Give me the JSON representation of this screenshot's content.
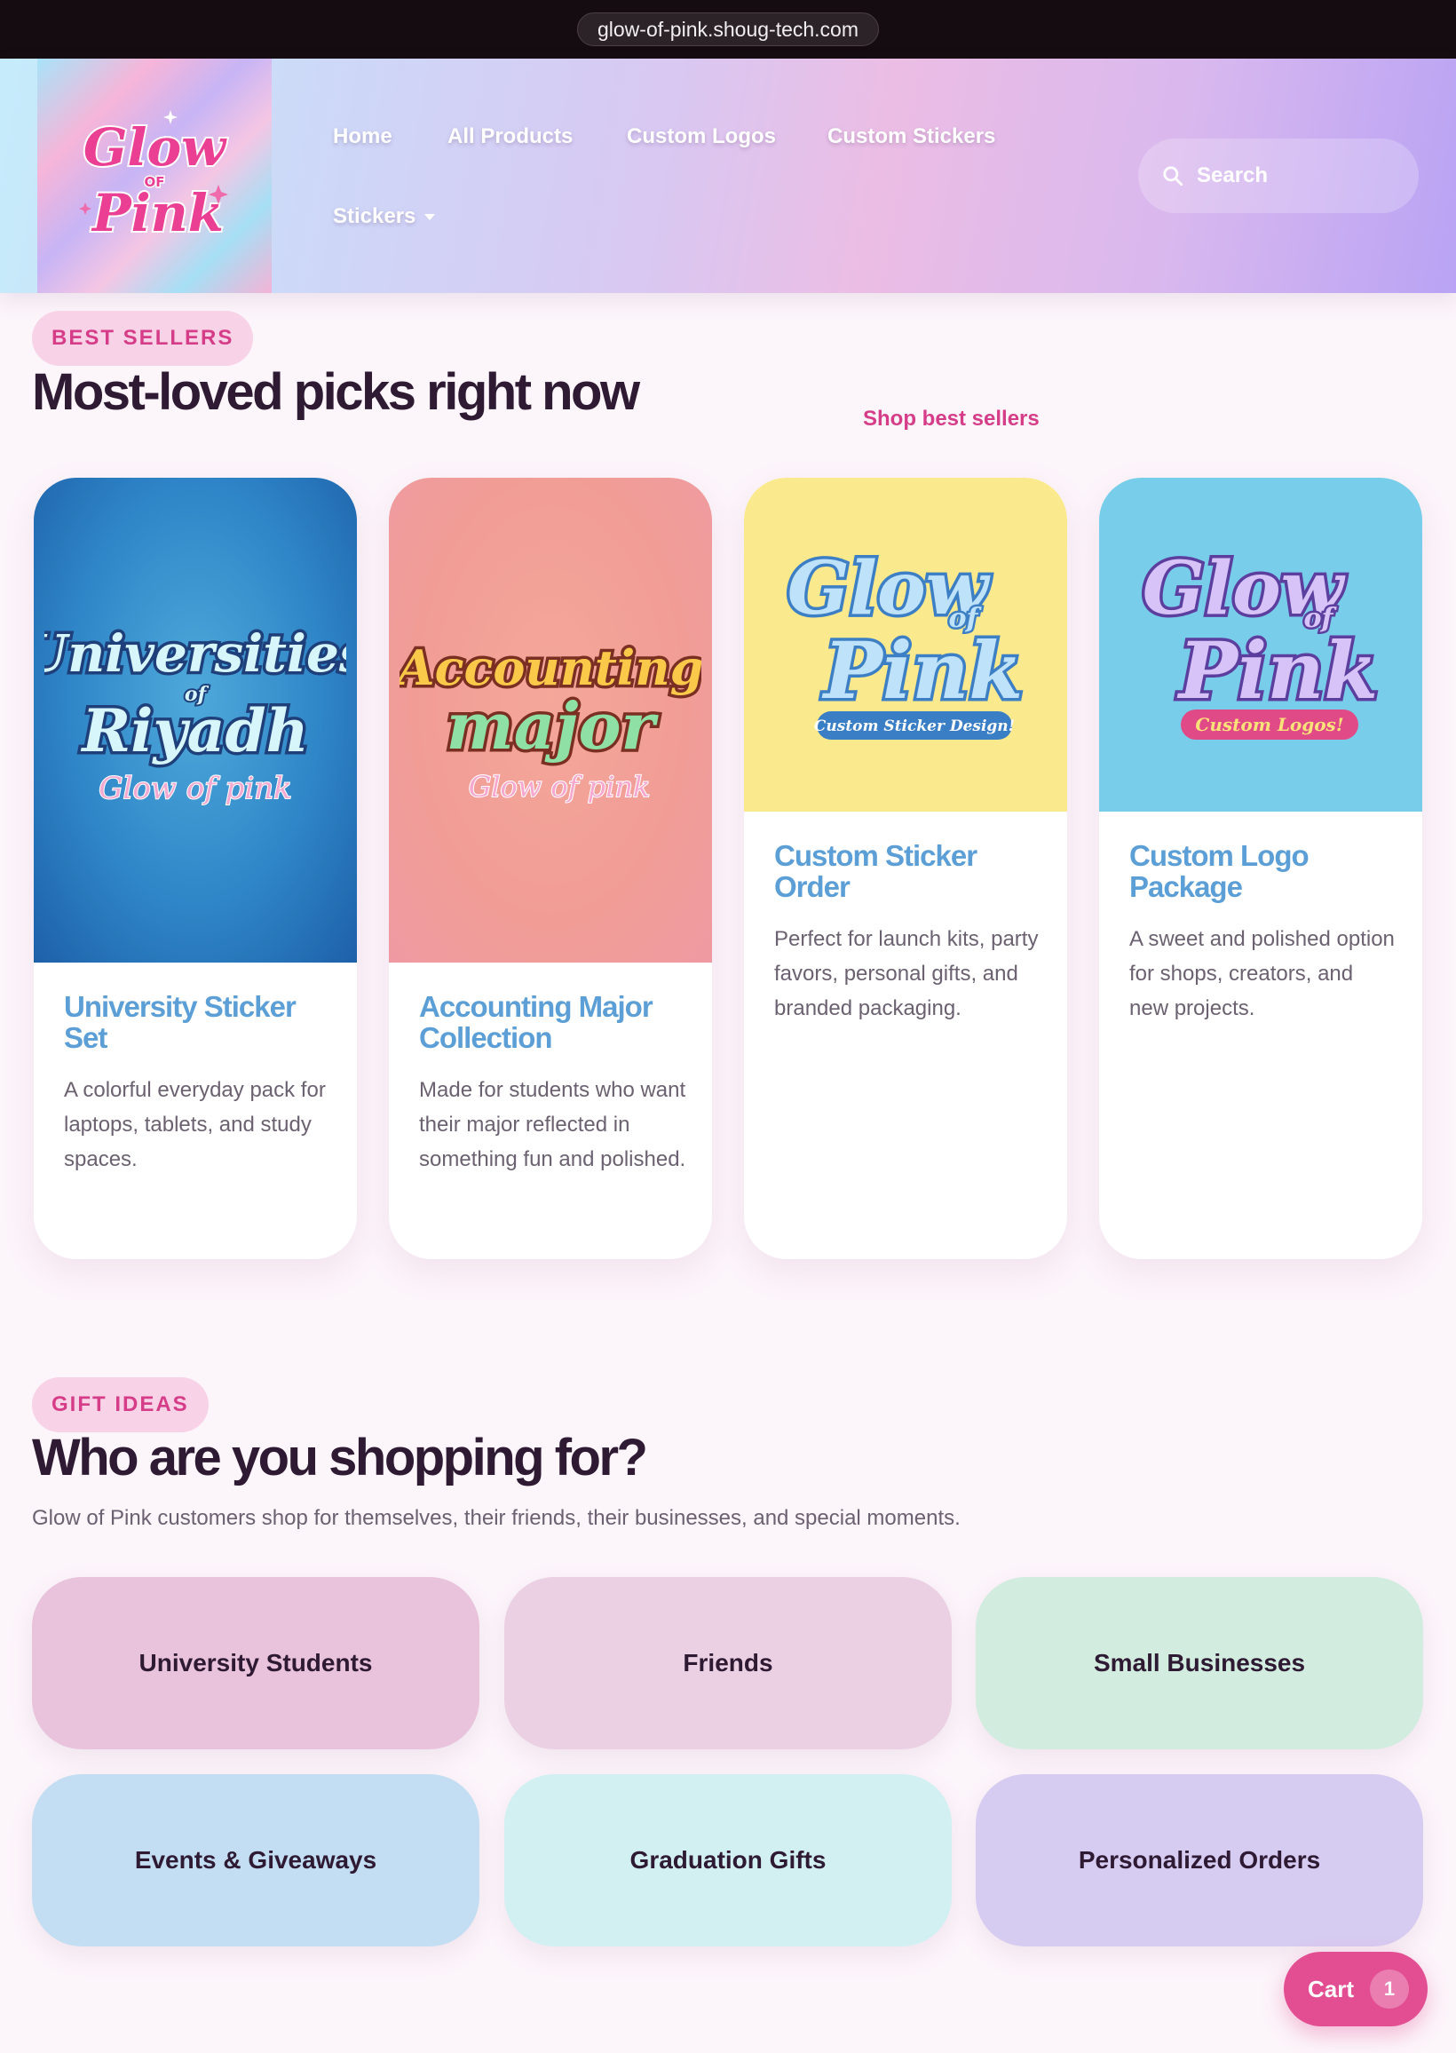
{
  "browser": {
    "url": "glow-of-pink.shoug-tech.com"
  },
  "header": {
    "logo": {
      "text_top": "Glow",
      "text_mid": "OF",
      "text_bottom": "Pink"
    },
    "nav": [
      {
        "label": "Home"
      },
      {
        "label": "All Products"
      },
      {
        "label": "Custom Logos"
      },
      {
        "label": "Custom Stickers"
      },
      {
        "label": "Stickers"
      }
    ],
    "search": {
      "placeholder": "Search",
      "icon": "search-icon"
    }
  },
  "best_sellers": {
    "eyebrow": "BEST SELLERS",
    "title": "Most-loved picks right now",
    "link": "Shop best sellers",
    "products": [
      {
        "title": "University Sticker Set",
        "description": "A colorful everyday pack for laptops, tablets, and study spaces.",
        "image": {
          "line1": "Universities",
          "line2": "of",
          "line3": "Riyadh",
          "line4": "Glow of pink"
        }
      },
      {
        "title": "Accounting Major Collection",
        "description": "Made for students who want their major reflected in something fun and polished.",
        "image": {
          "line1": "Accounting",
          "line2": "major",
          "line3": "Glow of pink"
        }
      },
      {
        "title": "Custom Sticker Order",
        "description": "Perfect for launch kits, party favors, personal gifts, and branded packaging.",
        "image": {
          "line1": "Glow",
          "line2": "of",
          "line3": "Pink",
          "banner": "Custom Sticker Design!"
        }
      },
      {
        "title": "Custom Logo Package",
        "description": "A sweet and polished option for shops, creators, and new projects.",
        "image": {
          "line1": "Glow",
          "line2": "of",
          "line3": "Pink",
          "banner": "Custom Logos!"
        }
      }
    ]
  },
  "gift_ideas": {
    "eyebrow": "GIFT IDEAS",
    "title": "Who are you shopping for?",
    "subtitle": "Glow of Pink customers shop for themselves, their friends, their businesses, and special moments.",
    "tiles": [
      {
        "label": "University Students",
        "color": "#e9c3dc"
      },
      {
        "label": "Friends",
        "color": "#ebcfe2"
      },
      {
        "label": "Small Businesses",
        "color": "#d2ecdf"
      },
      {
        "label": "Events & Giveaways",
        "color": "#c3def2"
      },
      {
        "label": "Graduation Gifts",
        "color": "#d2f0f2"
      },
      {
        "label": "Personalized Orders",
        "color": "#d6cbf0"
      }
    ]
  },
  "cart": {
    "label": "Cart",
    "count": "1"
  },
  "colors": {
    "accent_pink": "#d63d88",
    "card_title_blue": "#5b9fd6",
    "cart_pink": "#e34d92",
    "page_background": "#fcf5fa"
  }
}
